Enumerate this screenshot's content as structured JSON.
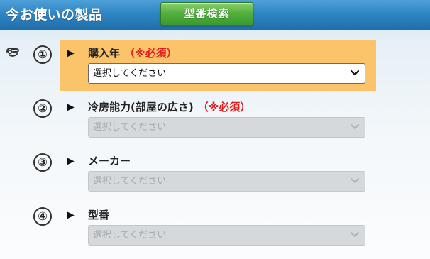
{
  "header": {
    "title": "今お使いの製品",
    "search_button": "型番検索"
  },
  "steps": [
    {
      "number": "①",
      "label": "購入年",
      "required": "（※必須）",
      "placeholder": "選択してください",
      "state": "active"
    },
    {
      "number": "②",
      "label": "冷房能力(部屋の広さ)",
      "required": "（※必須）",
      "placeholder": "選択してください",
      "state": "disabled"
    },
    {
      "number": "③",
      "label": "メーカー",
      "required": "",
      "placeholder": "選択してください",
      "state": "disabled"
    },
    {
      "number": "④",
      "label": "型番",
      "required": "",
      "placeholder": "選択してください",
      "state": "disabled"
    }
  ],
  "colors": {
    "header_blue": "#2f86c4",
    "button_green": "#55b040",
    "active_step_bg": "#fbc46a",
    "required_red": "#e21d1d"
  },
  "icons": {
    "pointer": "pointing-hand-icon",
    "arrow": "play-arrow-icon",
    "chevron": "chevron-down-icon"
  }
}
